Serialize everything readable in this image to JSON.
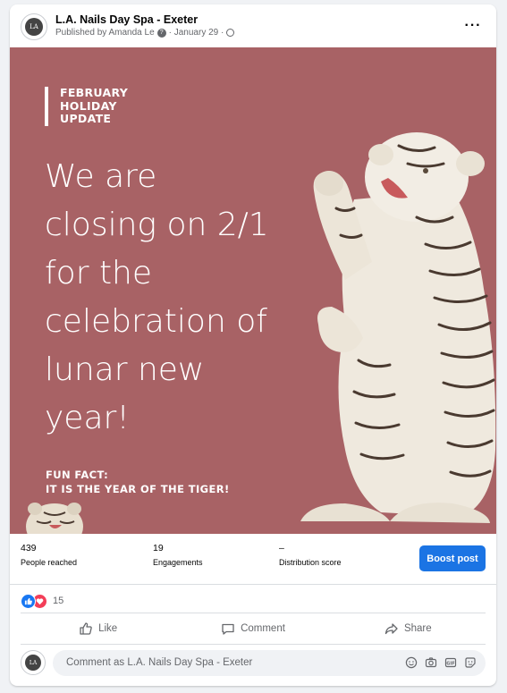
{
  "post": {
    "page_name": "L.A. Nails Day Spa - Exeter",
    "published_by": "Published by Amanda Le",
    "date": "· January 29 ·",
    "logo_text": "LA"
  },
  "image": {
    "background": "#a86265",
    "title": "FEBRUARY\nHOLIDAY\nUPDATE",
    "headline": "We are\nclosing on 2/1\nfor the\ncelebration of\nlunar new\nyear!",
    "fun_fact": "FUN FACT:\nIT IS THE YEAR OF THE TIGER!"
  },
  "stats": {
    "reached_value": "439",
    "reached_label": "People reached",
    "engagements_value": "19",
    "engagements_label": "Engagements",
    "distribution_value": "–",
    "distribution_label": "Distribution score",
    "boost_label": "Boost post"
  },
  "reactions": {
    "count": "15"
  },
  "actions": {
    "like": "Like",
    "comment": "Comment",
    "share": "Share"
  },
  "comment": {
    "placeholder": "Comment as L.A. Nails Day Spa - Exeter"
  },
  "colors": {
    "accent": "#1b74e4",
    "like": "#1877f2",
    "love": "#f33e58"
  }
}
